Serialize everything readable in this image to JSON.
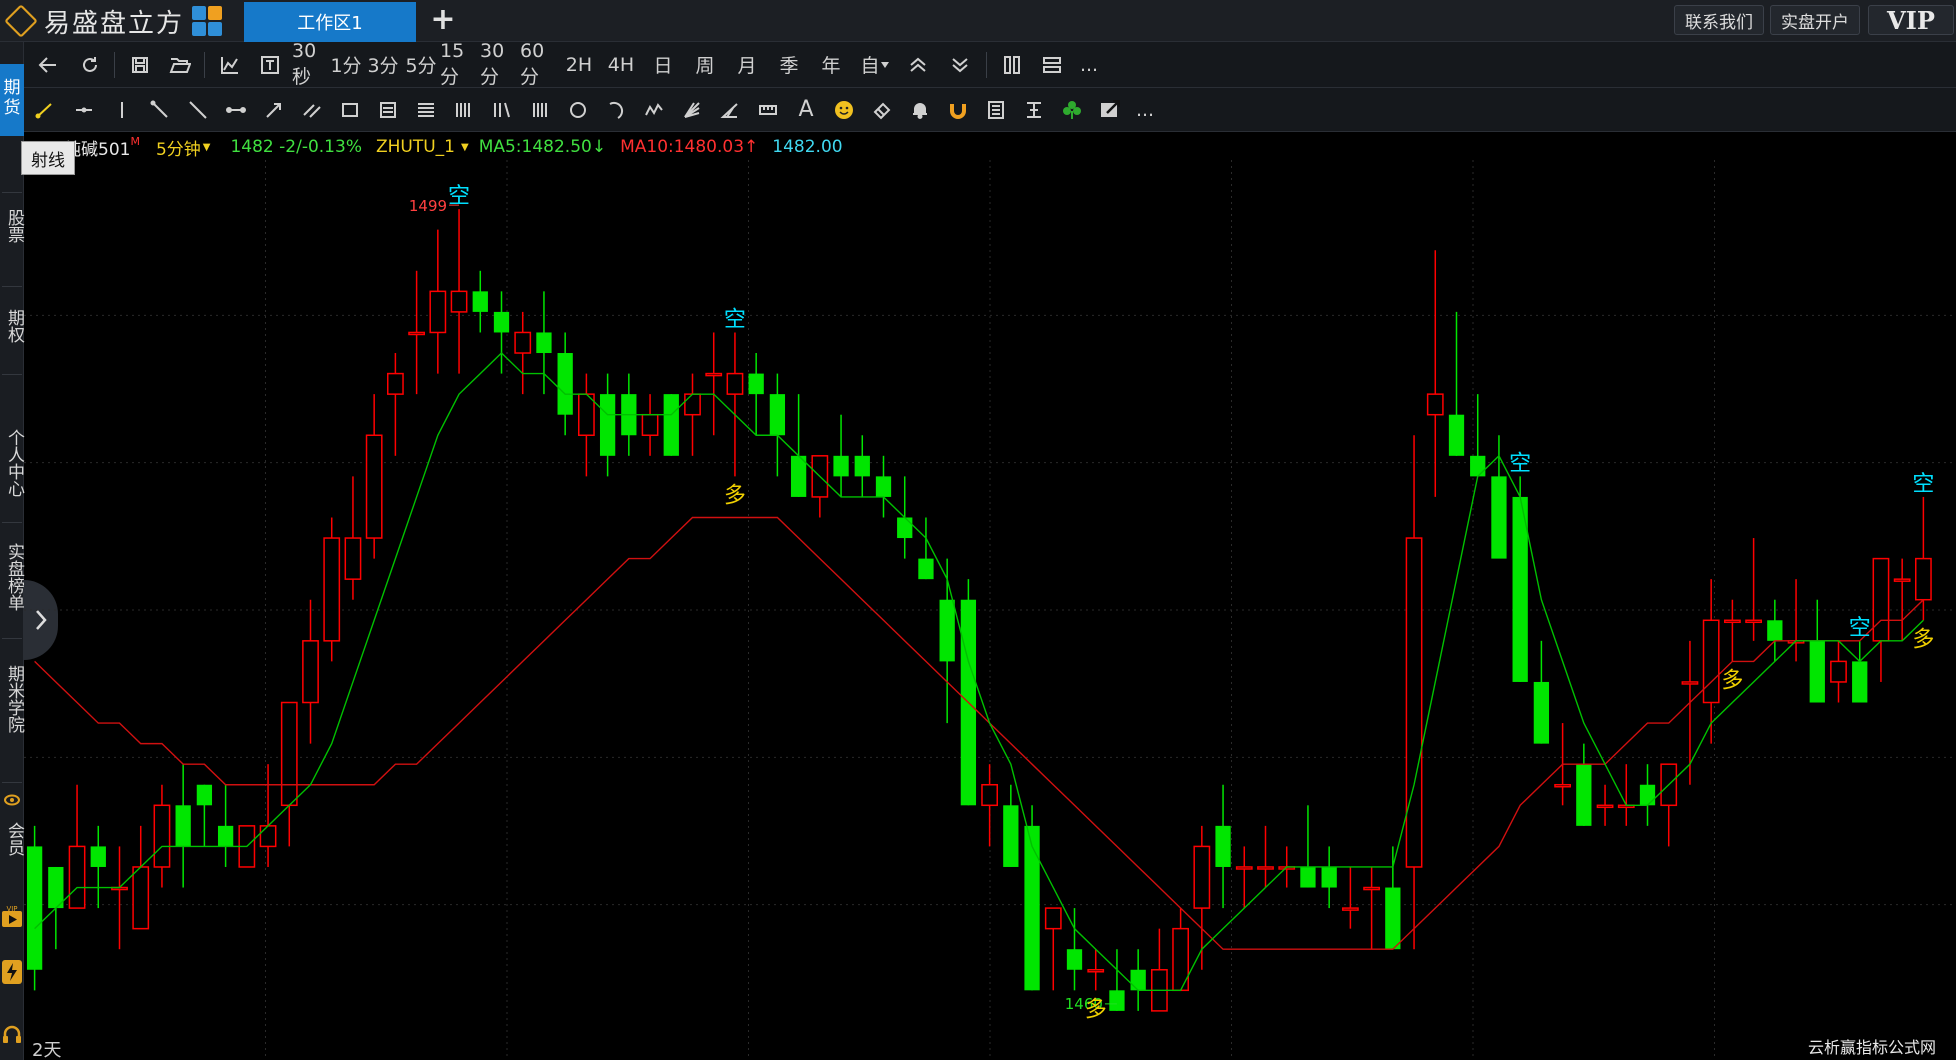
{
  "app": {
    "name": "易盛盘立方",
    "tab": "工作区1",
    "add_tab": "+"
  },
  "top_buttons": {
    "contact": "联系我们",
    "open_account": "实盘开户",
    "vip": "VIP"
  },
  "left_nav": [
    "期货",
    "股票",
    "期权",
    "个人中心",
    "实盘榜单",
    "期米学院",
    "会员"
  ],
  "toolbar1": {
    "periods": [
      "30秒",
      "1分",
      "3分",
      "5分",
      "15分",
      "30分",
      "60分",
      "2H",
      "4H",
      "日",
      "周",
      "月",
      "季",
      "年",
      "自"
    ],
    "more": "..."
  },
  "toolbar2": {
    "more": "...",
    "text_tool": "A"
  },
  "tooltip": "射线",
  "info": {
    "symbol": "纯碱501",
    "symbol_suffix": "M",
    "period": "5分钟",
    "price_change": "1482  -2/-0.13%",
    "indicator": "ZHUTU_1",
    "ma5": "MA5:1482.50",
    "ma5_arrow": "↓",
    "ma10": "MA10:1480.03",
    "ma10_arrow": "↑",
    "last": "1482.00"
  },
  "colors": {
    "up": "#ff0000",
    "down": "#00e600",
    "ma5": "#00c000",
    "ma10": "#d01010",
    "signal_short": "#00e0ff",
    "signal_long": "#f0d000"
  },
  "footer": {
    "range": "2天",
    "watermark": "云析赢指标公式网"
  },
  "chart_data": {
    "type": "candlestick",
    "high_label": "1499",
    "low_label": "1460",
    "ohlc": [
      [
        1468,
        1469,
        1461,
        1462
      ],
      [
        1467,
        1467,
        1463,
        1465
      ],
      [
        1465,
        1471,
        1465,
        1468
      ],
      [
        1468,
        1469,
        1465,
        1467
      ],
      [
        1466,
        1468,
        1463,
        1466
      ],
      [
        1464,
        1469,
        1464,
        1467
      ],
      [
        1467,
        1471,
        1466,
        1470
      ],
      [
        1470,
        1472,
        1466,
        1468
      ],
      [
        1471,
        1471,
        1468,
        1470
      ],
      [
        1469,
        1471,
        1467,
        1468
      ],
      [
        1467,
        1469,
        1467,
        1469
      ],
      [
        1468,
        1472,
        1467,
        1469
      ],
      [
        1470,
        1475,
        1468,
        1475
      ],
      [
        1475,
        1480,
        1473,
        1478
      ],
      [
        1478,
        1484,
        1477,
        1483
      ],
      [
        1481,
        1486,
        1480,
        1483
      ],
      [
        1483,
        1490,
        1482,
        1488
      ],
      [
        1490,
        1492,
        1487,
        1491
      ],
      [
        1493,
        1496,
        1490,
        1493
      ],
      [
        1493,
        1498,
        1491,
        1495
      ],
      [
        1494,
        1499,
        1491,
        1495
      ],
      [
        1495,
        1496,
        1493,
        1494
      ],
      [
        1494,
        1495,
        1491,
        1493
      ],
      [
        1492,
        1494,
        1490,
        1493
      ],
      [
        1493,
        1495,
        1490,
        1492
      ],
      [
        1492,
        1493,
        1488,
        1489
      ],
      [
        1488,
        1491,
        1486,
        1490
      ],
      [
        1490,
        1491,
        1486,
        1487
      ],
      [
        1490,
        1491,
        1487,
        1488
      ],
      [
        1488,
        1490,
        1487,
        1489
      ],
      [
        1490,
        1490,
        1487,
        1487
      ],
      [
        1489,
        1491,
        1487,
        1490
      ],
      [
        1491,
        1493,
        1488,
        1491
      ],
      [
        1490,
        1493,
        1486,
        1491
      ],
      [
        1491,
        1492,
        1488,
        1490
      ],
      [
        1490,
        1491,
        1486,
        1488
      ],
      [
        1487,
        1490,
        1485,
        1485
      ],
      [
        1485,
        1487,
        1484,
        1487
      ],
      [
        1487,
        1489,
        1485,
        1486
      ],
      [
        1487,
        1488,
        1485,
        1486
      ],
      [
        1486,
        1487,
        1484,
        1485
      ],
      [
        1484,
        1486,
        1482,
        1483
      ],
      [
        1482,
        1484,
        1481,
        1481
      ],
      [
        1480,
        1482,
        1474,
        1477
      ],
      [
        1480,
        1481,
        1470,
        1470
      ],
      [
        1470,
        1472,
        1468,
        1471
      ],
      [
        1470,
        1471,
        1467,
        1467
      ],
      [
        1469,
        1470,
        1461,
        1461
      ],
      [
        1464,
        1465,
        1461,
        1465
      ],
      [
        1463,
        1465,
        1461,
        1462
      ],
      [
        1462,
        1463,
        1461,
        1462
      ],
      [
        1461,
        1463,
        1460,
        1460
      ],
      [
        1462,
        1463,
        1460,
        1461
      ],
      [
        1460,
        1464,
        1460,
        1462
      ],
      [
        1461,
        1465,
        1461,
        1464
      ],
      [
        1465,
        1469,
        1462,
        1468
      ],
      [
        1469,
        1471,
        1465,
        1467
      ],
      [
        1467,
        1468,
        1465,
        1467
      ],
      [
        1467,
        1469,
        1466,
        1467
      ],
      [
        1467,
        1468,
        1466,
        1467
      ],
      [
        1467,
        1470,
        1466,
        1466
      ],
      [
        1467,
        1468,
        1465,
        1466
      ],
      [
        1465,
        1467,
        1464,
        1465
      ],
      [
        1466,
        1467,
        1463,
        1466
      ],
      [
        1466,
        1468,
        1465,
        1463
      ],
      [
        1467,
        1488,
        1463,
        1483
      ],
      [
        1489,
        1497,
        1485,
        1490
      ],
      [
        1489,
        1494,
        1487,
        1487
      ],
      [
        1487,
        1490,
        1486,
        1486
      ],
      [
        1486,
        1488,
        1484,
        1482
      ],
      [
        1485,
        1486,
        1476,
        1476
      ],
      [
        1476,
        1478,
        1473,
        1473
      ],
      [
        1471,
        1474,
        1470,
        1471
      ],
      [
        1472,
        1473,
        1469,
        1469
      ],
      [
        1470,
        1471,
        1469,
        1470
      ],
      [
        1470,
        1472,
        1469,
        1470
      ],
      [
        1471,
        1472,
        1469,
        1470
      ],
      [
        1470,
        1472,
        1468,
        1472
      ],
      [
        1476,
        1478,
        1471,
        1476
      ],
      [
        1475,
        1481,
        1473,
        1479
      ],
      [
        1479,
        1480,
        1477,
        1479
      ],
      [
        1479,
        1483,
        1478,
        1479
      ],
      [
        1479,
        1480,
        1477,
        1478
      ],
      [
        1478,
        1481,
        1477,
        1478
      ],
      [
        1478,
        1480,
        1475,
        1475
      ],
      [
        1476,
        1478,
        1475,
        1477
      ],
      [
        1477,
        1478,
        1475,
        1475
      ],
      [
        1478,
        1480,
        1476,
        1482
      ],
      [
        1481,
        1482,
        1478,
        1481
      ],
      [
        1480,
        1485,
        1479,
        1482
      ]
    ],
    "ma5": [
      1464,
      1465,
      1466,
      1466,
      1466,
      1467,
      1468,
      1468,
      1468,
      1468,
      1468,
      1469,
      1470,
      1471,
      1473,
      1476,
      1479,
      1482,
      1485,
      1488,
      1490,
      1491,
      1492,
      1491,
      1491,
      1490,
      1490,
      1489,
      1489,
      1489,
      1489,
      1490,
      1490,
      1489,
      1488,
      1488,
      1487,
      1486,
      1485,
      1485,
      1485,
      1484,
      1483,
      1481,
      1477,
      1474,
      1472,
      1468,
      1466,
      1464,
      1463,
      1462,
      1461,
      1461,
      1461,
      1463,
      1464,
      1465,
      1466,
      1467,
      1467,
      1467,
      1467,
      1467,
      1467,
      1471,
      1476,
      1481,
      1486,
      1487,
      1485,
      1480,
      1477,
      1474,
      1472,
      1470,
      1470,
      1471,
      1472,
      1474,
      1475,
      1476,
      1477,
      1478,
      1478,
      1478,
      1477,
      1478,
      1478,
      1479
    ],
    "ma10": [
      1477,
      1476,
      1475,
      1474,
      1474,
      1473,
      1473,
      1472,
      1472,
      1471,
      1471,
      1471,
      1471,
      1471,
      1471,
      1471,
      1471,
      1472,
      1472,
      1473,
      1474,
      1475,
      1476,
      1477,
      1478,
      1479,
      1480,
      1481,
      1482,
      1482,
      1483,
      1484,
      1484,
      1484,
      1484,
      1484,
      1483,
      1482,
      1481,
      1480,
      1479,
      1478,
      1477,
      1476,
      1475,
      1474,
      1473,
      1472,
      1471,
      1470,
      1469,
      1468,
      1467,
      1466,
      1465,
      1464,
      1463,
      1463,
      1463,
      1463,
      1463,
      1463,
      1463,
      1463,
      1463,
      1464,
      1465,
      1466,
      1467,
      1468,
      1470,
      1471,
      1472,
      1472,
      1472,
      1473,
      1474,
      1474,
      1475,
      1476,
      1477,
      1477,
      1478,
      1478,
      1478,
      1478,
      1478,
      1479,
      1479,
      1480
    ],
    "signals": [
      {
        "index": 20,
        "label": "空",
        "side": "short"
      },
      {
        "index": 33,
        "label": "空",
        "side": "short"
      },
      {
        "index": 33,
        "label": "多",
        "side": "long"
      },
      {
        "index": 50,
        "label": "多",
        "side": "long"
      },
      {
        "index": 70,
        "label": "空",
        "side": "short"
      },
      {
        "index": 80,
        "label": "多",
        "side": "long"
      },
      {
        "index": 86,
        "label": "空",
        "side": "short"
      },
      {
        "index": 89,
        "label": "多",
        "side": "long"
      },
      {
        "index": 89,
        "label": "空",
        "side": "short"
      }
    ],
    "ylim": [
      1458,
      1501
    ]
  }
}
